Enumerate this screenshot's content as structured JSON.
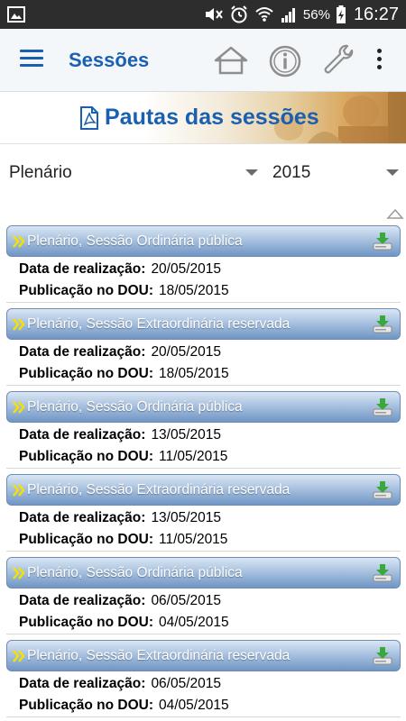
{
  "status_bar": {
    "battery": "56%",
    "time": "16:27",
    "icons": [
      "gallery-icon",
      "mute-icon",
      "alarm-icon",
      "wifi-icon",
      "signal-icon",
      "battery-icon"
    ]
  },
  "app_bar": {
    "title": "Sessões",
    "icons": [
      "menu-icon",
      "home-icon",
      "info-icon",
      "wrench-icon",
      "overflow-icon"
    ]
  },
  "banner": {
    "title": "Pautas das sessões",
    "icon": "pdf-icon"
  },
  "filters": {
    "colegiado": "Plenário",
    "ano": "2015"
  },
  "labels": {
    "data_realizacao": "Data de realização:",
    "publicacao_dou": "Publicação no DOU:"
  },
  "sessions": [
    {
      "title": "Plenário, Sessão Ordinária pública",
      "data_realizacao": "20/05/2015",
      "publicacao_dou": "18/05/2015"
    },
    {
      "title": "Plenário, Sessão Extraordinária reservada",
      "data_realizacao": "20/05/2015",
      "publicacao_dou": "18/05/2015"
    },
    {
      "title": "Plenário, Sessão Ordinária pública",
      "data_realizacao": "13/05/2015",
      "publicacao_dou": "11/05/2015"
    },
    {
      "title": "Plenário, Sessão Extraordinária reservada",
      "data_realizacao": "13/05/2015",
      "publicacao_dou": "11/05/2015"
    },
    {
      "title": "Plenário, Sessão Ordinária pública",
      "data_realizacao": "06/05/2015",
      "publicacao_dou": "04/05/2015"
    },
    {
      "title": "Plenário, Sessão Extraordinária reservada",
      "data_realizacao": "06/05/2015",
      "publicacao_dou": "04/05/2015"
    }
  ],
  "colors": {
    "accent": "#1a5fb0",
    "header_gradient_top": "#dbe6f3",
    "header_gradient_bottom": "#6f95c4",
    "chevron": "#f5e000",
    "status_bar": "#2d2d2d"
  }
}
